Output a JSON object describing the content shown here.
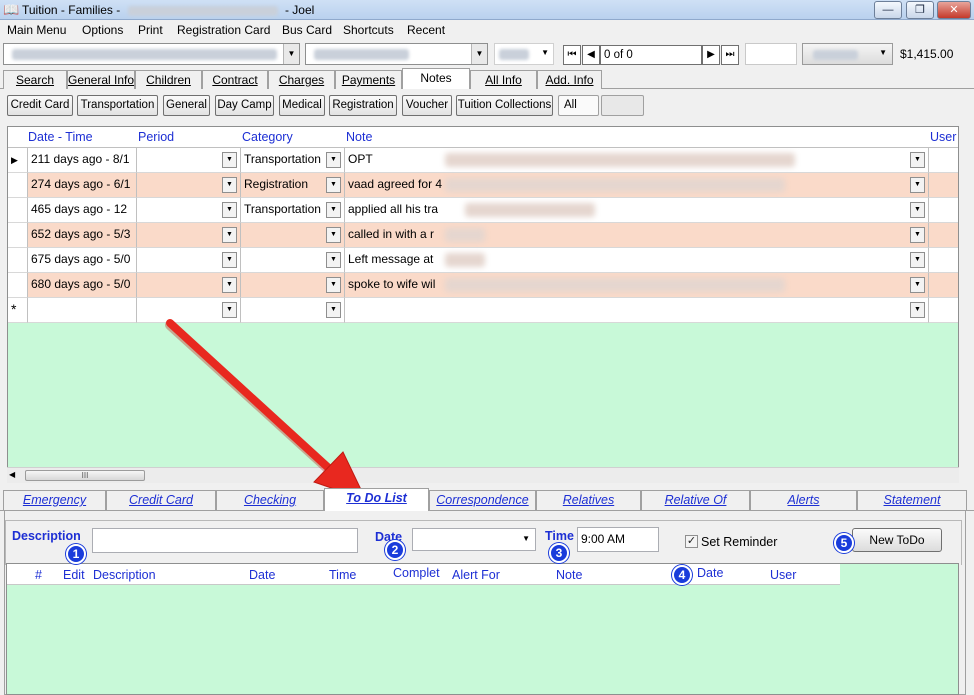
{
  "window": {
    "title_prefix": "Tuition - Families -",
    "title_suffix": "- Joel",
    "minimize_label": "—",
    "restore_label": "❐",
    "close_label": "✕"
  },
  "menu": [
    "Main Menu",
    "Options",
    "Print",
    "Registration Card",
    "Bus Card",
    "Shortcuts",
    "Recent"
  ],
  "toolbar": {
    "record_position": "0 of 0",
    "balance": "$1,415.00"
  },
  "top_tabs": [
    "Search",
    "General Info",
    "Children",
    "Contract",
    "Charges",
    "Payments",
    "Notes",
    "All Info",
    "Add. Info"
  ],
  "active_top_tab": "Notes",
  "note_filters": [
    "Credit Card",
    "Transportation",
    "General",
    "Day Camp",
    "Medical",
    "Registration",
    "Voucher",
    "Tuition Collections",
    "All"
  ],
  "notes_grid": {
    "columns": [
      "Date - Time",
      "Period",
      "Category",
      "Note",
      "User"
    ],
    "rows": [
      {
        "date": "211 days ago - 8/1",
        "category": "Transportation",
        "note": "OPT"
      },
      {
        "date": "274 days ago - 6/1",
        "category": "Registration",
        "note": "vaad agreed for 4"
      },
      {
        "date": "465 days ago - 12",
        "category": "Transportation",
        "note": "applied all his tra"
      },
      {
        "date": "652 days ago - 5/3",
        "category": "",
        "note": "called in with a r"
      },
      {
        "date": "675 days ago - 5/0",
        "category": "",
        "note": "Left message at"
      },
      {
        "date": "680 days ago - 5/0",
        "category": "",
        "note": "spoke to wife wil"
      }
    ],
    "new_row_marker": "*",
    "scroll_grip": "III"
  },
  "lower_tabs": [
    "Emergency",
    "Credit Card",
    "Checking",
    "To Do List",
    "Correspondence",
    "Relatives",
    "Relative Of",
    "Alerts",
    "Statement"
  ],
  "active_lower_tab": "To Do List",
  "todo": {
    "description_label": "Description",
    "date_label": "Date",
    "time_label": "Time",
    "time_value": "9:00 AM",
    "set_reminder_label": "Set Reminder",
    "set_reminder_checked": true,
    "new_todo_label": "New ToDo",
    "columns": [
      "#",
      "Edit",
      "Description",
      "Date",
      "Time",
      "Complet",
      "Alert For",
      "Note",
      "Date",
      "User"
    ]
  },
  "badges": [
    "1",
    "2",
    "3",
    "4",
    "5"
  ],
  "colors": {
    "grid_bg": "#c8f9d8",
    "row_alt": "#fadac9",
    "header_text": "#1d2fd4",
    "badge": "#1a3cdb",
    "arrow": "#e8281f"
  }
}
